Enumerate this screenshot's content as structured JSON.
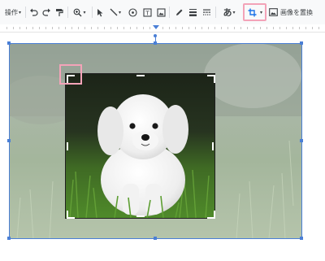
{
  "toolbar": {
    "operation_label": "操作",
    "replace_image_label": "画像を置換",
    "text_style_glyph": "あ",
    "icons": [
      "chevron-down-icon",
      "undo-icon",
      "redo-icon",
      "paint-format-icon",
      "zoom-icon",
      "select-icon",
      "line-icon",
      "textbox-icon",
      "shape-icon",
      "image-icon",
      "pen-icon",
      "line-weight-icon",
      "line-dash-icon",
      "text-style-icon",
      "crop-icon",
      "replace-image-icon"
    ]
  },
  "colors": {
    "selection": "#4a7fd6",
    "highlight": "#f3a3b8",
    "toolbar_bg": "#f8f9fa"
  },
  "image": {
    "subject": "white puppy sitting on grass"
  }
}
